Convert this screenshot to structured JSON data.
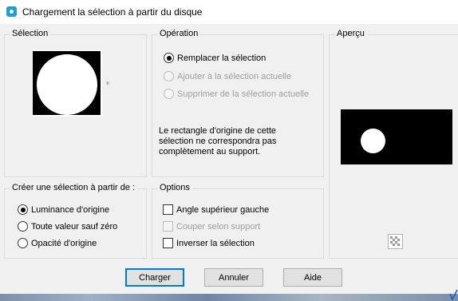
{
  "window": {
    "title": "Chargement la sélection à partir du disque"
  },
  "selection_group": {
    "label": "Sélection"
  },
  "operation_group": {
    "label": "Opération",
    "options": [
      {
        "label": "Remplacer la sélection",
        "checked": true,
        "enabled": true
      },
      {
        "label": "Ajouter à la sélection actuelle",
        "checked": false,
        "enabled": false
      },
      {
        "label": "Supprimer de la sélection actuelle",
        "checked": false,
        "enabled": false
      }
    ],
    "note_lines": [
      "Le rectangle d'origine de cette",
      "sélection ne correspondra pas",
      "complètement au support."
    ]
  },
  "preview_group": {
    "label": "Aperçu",
    "icon": "checkerboard-icon"
  },
  "create_from_group": {
    "label": "Créer une sélection à partir de :",
    "options": [
      {
        "label": "Luminance d'origine",
        "checked": true
      },
      {
        "label": "Toute valeur sauf zéro",
        "checked": false
      },
      {
        "label": "Opacité d'origine",
        "checked": false
      }
    ]
  },
  "options_group": {
    "label": "Options",
    "checkboxes": [
      {
        "label": "Angle supérieur gauche",
        "checked": false,
        "enabled": true
      },
      {
        "label": "Couper selon support",
        "checked": false,
        "enabled": false
      },
      {
        "label": "Inverser la sélection",
        "checked": false,
        "enabled": true
      }
    ]
  },
  "buttons": {
    "load": "Charger",
    "cancel": "Annuler",
    "help": "Aide"
  }
}
